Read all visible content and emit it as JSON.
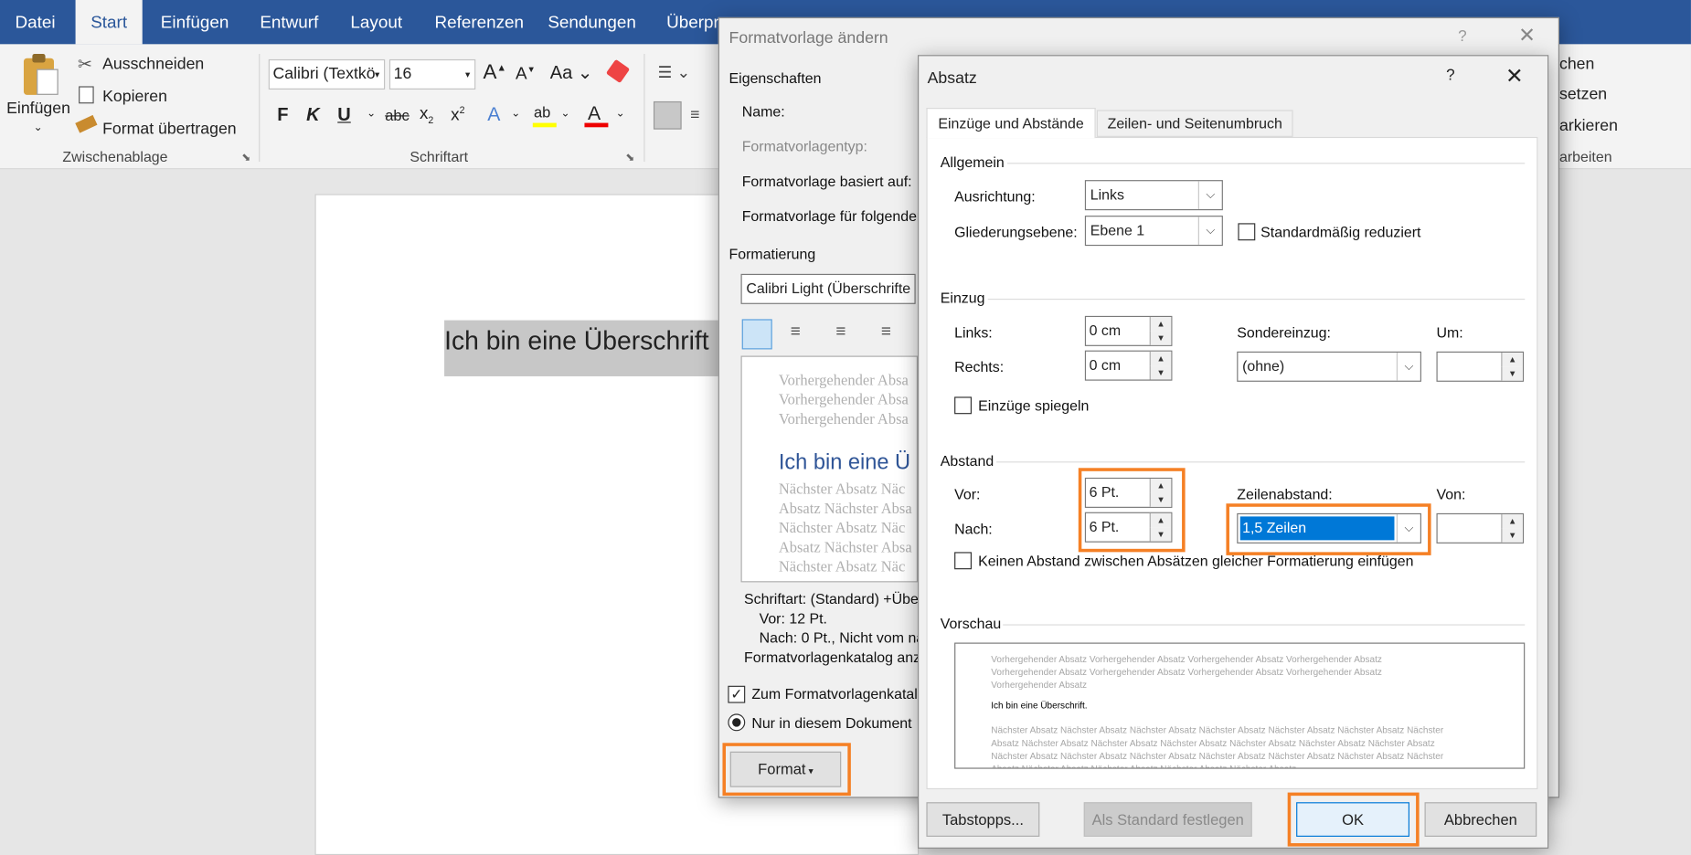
{
  "tabs": [
    "Datei",
    "Start",
    "Einfügen",
    "Entwurf",
    "Layout",
    "Referenzen",
    "Sendungen",
    "Überpr"
  ],
  "ribbon": {
    "paste_label": "Einfügen",
    "cut_label": "Ausschneiden",
    "copy_label": "Kopieren",
    "format_painter_label": "Format übertragen",
    "clipboard_group": "Zwischenablage",
    "font_name": "Calibri (Textkö",
    "font_size": "16",
    "font_group": "Schriftart",
    "right_items": [
      "chen",
      "setzen",
      "arkieren",
      "arbeiten"
    ]
  },
  "document": {
    "heading_text": "Ich bin eine Überschrift"
  },
  "format_dialog": {
    "title": "Formatvorlage ändern",
    "properties_label": "Eigenschaften",
    "name_label": "Name:",
    "type_label": "Formatvorlagentyp:",
    "based_on_label": "Formatvorlage basiert auf:",
    "following_label": "Formatvorlage für folgenden",
    "formatting_label": "Formatierung",
    "font_combo": "Calibri Light (Überschrifte",
    "preview_prev": [
      "Vorhergehender Absa",
      "Vorhergehender Absa",
      "Vorhergehender Absa"
    ],
    "preview_heading": "Ich bin eine Ü",
    "preview_next": [
      "Nächster Absatz Näc",
      "Absatz Nächster Absa",
      "Nächster Absatz Näc",
      "Absatz Nächster Absa",
      "Nächster Absatz Näc"
    ],
    "desc_lines": [
      "Schriftart: (Standard) +Über",
      "Vor:  12 Pt.",
      "Nach:  0 Pt., Nicht vom nä",
      "Formatvorlagenkatalog anz"
    ],
    "add_gallery_label": "Zum Formatvorlagenkatalo",
    "only_doc_label": "Nur in diesem Dokument",
    "format_button": "Format"
  },
  "para_dialog": {
    "title": "Absatz",
    "help": "?",
    "tab_indents": "Einzüge und Abstände",
    "tab_breaks": "Zeilen- und Seitenumbruch",
    "general_label": "Allgemein",
    "alignment_label": "Ausrichtung:",
    "alignment_value": "Links",
    "outline_label": "Gliederungsebene:",
    "outline_value": "Ebene 1",
    "collapsed_label": "Standardmäßig reduziert",
    "indent_label": "Einzug",
    "left_label": "Links:",
    "left_value": "0 cm",
    "right_label": "Rechts:",
    "right_value": "0 cm",
    "special_label": "Sondereinzug:",
    "special_value": "(ohne)",
    "by_label": "Um:",
    "mirror_label": "Einzüge spiegeln",
    "spacing_label": "Abstand",
    "before_label": "Vor:",
    "before_value": "6 Pt.",
    "after_label": "Nach:",
    "after_value": "6 Pt.",
    "line_spacing_label": "Zeilenabstand:",
    "line_spacing_value": "1,5 Zeilen",
    "at_label": "Von:",
    "no_space_label": "Keinen Abstand zwischen Absätzen gleicher Formatierung einfügen",
    "preview_label": "Vorschau",
    "preview_prev": "Vorhergehender Absatz Vorhergehender Absatz Vorhergehender Absatz Vorhergehender Absatz Vorhergehender Absatz Vorhergehender Absatz Vorhergehender Absatz Vorhergehender Absatz Vorhergehender Absatz",
    "preview_heading": "Ich bin eine Überschrift.",
    "preview_next": "Nächster Absatz Nächster Absatz Nächster Absatz Nächster Absatz Nächster Absatz Nächster Absatz Nächster Absatz Nächster Absatz Nächster Absatz Nächster Absatz Nächster Absatz Nächster Absatz Nächster Absatz Nächster Absatz Nächster Absatz Nächster Absatz Nächster Absatz Nächster Absatz Nächster Absatz Nächster Absatz Nächster Absatz Nächster Absatz Nächster Absatz Nächster Absatz",
    "tabs_button": "Tabstopps...",
    "default_button": "Als Standard festlegen",
    "ok_button": "OK",
    "cancel_button": "Abbrechen"
  },
  "colors": {
    "brand": "#2b579a",
    "highlight": "#f58025",
    "selection": "#0078d7"
  }
}
